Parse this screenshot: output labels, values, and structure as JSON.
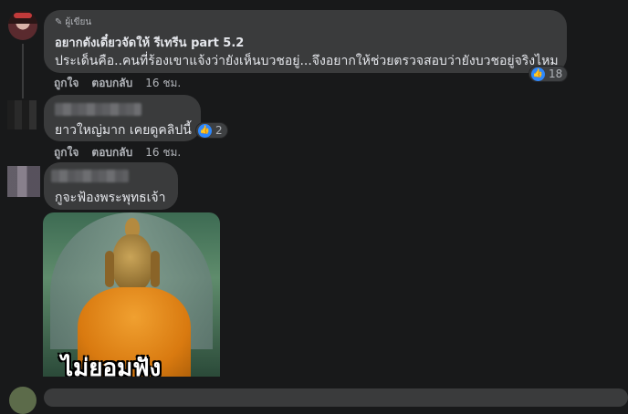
{
  "comments": [
    {
      "author_badge": "ผู้เขียน",
      "author": "อยากดังเดี๋ยวจัดให้ รีเทรีน part 5.2",
      "text": "ประเด็นคือ..คนที่ร้องเขาแจ้งว่ายังเห็นบวชอยู่...จึงอยากให้ช่วยตรวจสอบว่ายังบวชอยู่จริงไหม",
      "reactions": "18",
      "like_label": "ถูกใจ",
      "reply_label": "ตอบกลับ",
      "time": "16 ชม."
    },
    {
      "text": "ยาวใหญ่มาก เคยดูคลิปนี้",
      "reactions": "2",
      "like_label": "ถูกใจ",
      "reply_label": "ตอบกลับ",
      "time": "16 ชม."
    },
    {
      "text": "กูจะฟ้องพระพุทธเจ้า",
      "image_caption": "ไม่ยอมฟัง"
    }
  ],
  "icons": {
    "author_badge_icon": "pencil-icon",
    "reaction_icon": "thumbs-up-icon"
  },
  "colors": {
    "background": "#18191a",
    "bubble": "#3a3b3c",
    "like_blue": "#2d88ff",
    "muted_text": "#b0b3b8"
  }
}
